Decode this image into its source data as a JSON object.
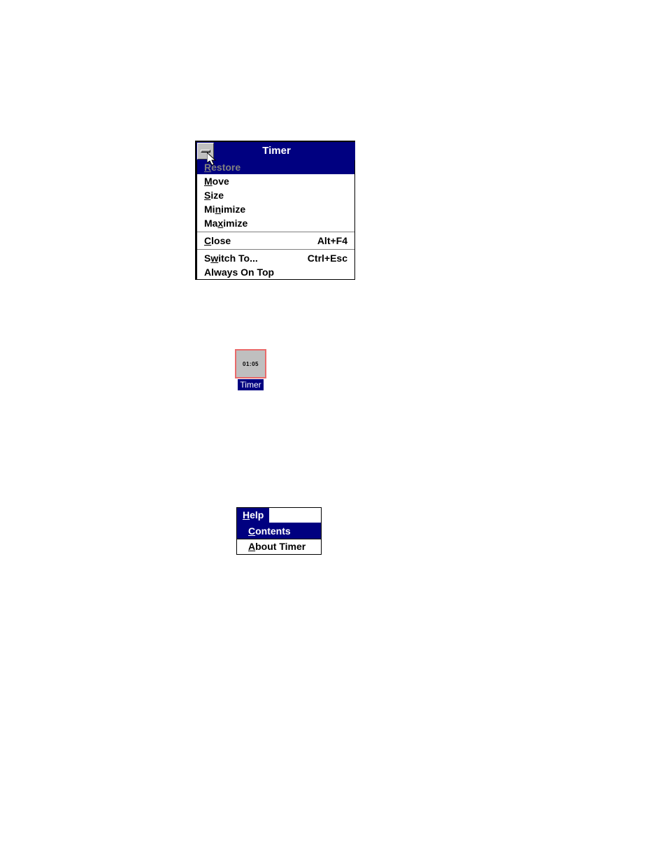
{
  "sysmenu": {
    "title": "Timer",
    "items": [
      {
        "pre": "",
        "u": "R",
        "post": "estore",
        "shortcut": "",
        "selected": true
      },
      {
        "pre": "",
        "u": "M",
        "post": "ove",
        "shortcut": "",
        "selected": false
      },
      {
        "pre": "",
        "u": "S",
        "post": "ize",
        "shortcut": "",
        "selected": false
      },
      {
        "pre": "Mi",
        "u": "n",
        "post": "imize",
        "shortcut": "",
        "selected": false
      },
      {
        "pre": "Ma",
        "u": "x",
        "post": "imize",
        "shortcut": "",
        "selected": false
      }
    ],
    "items2": [
      {
        "pre": "",
        "u": "C",
        "post": "lose",
        "shortcut": "Alt+F4",
        "selected": false
      }
    ],
    "items3": [
      {
        "pre": "S",
        "u": "w",
        "post": "itch To...",
        "shortcut": "Ctrl+Esc",
        "selected": false
      },
      {
        "pre": "Always On Top",
        "u": "",
        "post": "",
        "shortcut": "",
        "selected": false
      }
    ]
  },
  "icon": {
    "time": "01:05",
    "caption": "Timer"
  },
  "helpmenu": {
    "bar": {
      "pre": "",
      "u": "H",
      "post": "elp"
    },
    "rows": [
      {
        "pre": "",
        "u": "C",
        "post": "ontents",
        "selected": true
      },
      {
        "pre": "",
        "u": "A",
        "post": "bout Timer",
        "selected": false
      }
    ]
  }
}
